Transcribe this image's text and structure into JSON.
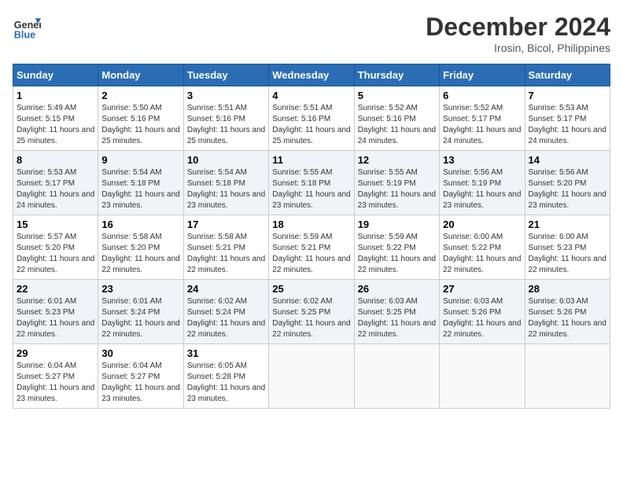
{
  "header": {
    "logo_line1": "General",
    "logo_line2": "Blue",
    "title": "December 2024",
    "subtitle": "Irosin, Bicol, Philippines"
  },
  "weekdays": [
    "Sunday",
    "Monday",
    "Tuesday",
    "Wednesday",
    "Thursday",
    "Friday",
    "Saturday"
  ],
  "weeks": [
    [
      {
        "day": "1",
        "sunrise": "5:49 AM",
        "sunset": "5:15 PM",
        "daylight": "11 hours and 25 minutes."
      },
      {
        "day": "2",
        "sunrise": "5:50 AM",
        "sunset": "5:16 PM",
        "daylight": "11 hours and 25 minutes."
      },
      {
        "day": "3",
        "sunrise": "5:51 AM",
        "sunset": "5:16 PM",
        "daylight": "11 hours and 25 minutes."
      },
      {
        "day": "4",
        "sunrise": "5:51 AM",
        "sunset": "5:16 PM",
        "daylight": "11 hours and 25 minutes."
      },
      {
        "day": "5",
        "sunrise": "5:52 AM",
        "sunset": "5:16 PM",
        "daylight": "11 hours and 24 minutes."
      },
      {
        "day": "6",
        "sunrise": "5:52 AM",
        "sunset": "5:17 PM",
        "daylight": "11 hours and 24 minutes."
      },
      {
        "day": "7",
        "sunrise": "5:53 AM",
        "sunset": "5:17 PM",
        "daylight": "11 hours and 24 minutes."
      }
    ],
    [
      {
        "day": "8",
        "sunrise": "5:53 AM",
        "sunset": "5:17 PM",
        "daylight": "11 hours and 24 minutes."
      },
      {
        "day": "9",
        "sunrise": "5:54 AM",
        "sunset": "5:18 PM",
        "daylight": "11 hours and 23 minutes."
      },
      {
        "day": "10",
        "sunrise": "5:54 AM",
        "sunset": "5:18 PM",
        "daylight": "11 hours and 23 minutes."
      },
      {
        "day": "11",
        "sunrise": "5:55 AM",
        "sunset": "5:18 PM",
        "daylight": "11 hours and 23 minutes."
      },
      {
        "day": "12",
        "sunrise": "5:55 AM",
        "sunset": "5:19 PM",
        "daylight": "11 hours and 23 minutes."
      },
      {
        "day": "13",
        "sunrise": "5:56 AM",
        "sunset": "5:19 PM",
        "daylight": "11 hours and 23 minutes."
      },
      {
        "day": "14",
        "sunrise": "5:56 AM",
        "sunset": "5:20 PM",
        "daylight": "11 hours and 23 minutes."
      }
    ],
    [
      {
        "day": "15",
        "sunrise": "5:57 AM",
        "sunset": "5:20 PM",
        "daylight": "11 hours and 22 minutes."
      },
      {
        "day": "16",
        "sunrise": "5:58 AM",
        "sunset": "5:20 PM",
        "daylight": "11 hours and 22 minutes."
      },
      {
        "day": "17",
        "sunrise": "5:58 AM",
        "sunset": "5:21 PM",
        "daylight": "11 hours and 22 minutes."
      },
      {
        "day": "18",
        "sunrise": "5:59 AM",
        "sunset": "5:21 PM",
        "daylight": "11 hours and 22 minutes."
      },
      {
        "day": "19",
        "sunrise": "5:59 AM",
        "sunset": "5:22 PM",
        "daylight": "11 hours and 22 minutes."
      },
      {
        "day": "20",
        "sunrise": "6:00 AM",
        "sunset": "5:22 PM",
        "daylight": "11 hours and 22 minutes."
      },
      {
        "day": "21",
        "sunrise": "6:00 AM",
        "sunset": "5:23 PM",
        "daylight": "11 hours and 22 minutes."
      }
    ],
    [
      {
        "day": "22",
        "sunrise": "6:01 AM",
        "sunset": "5:23 PM",
        "daylight": "11 hours and 22 minutes."
      },
      {
        "day": "23",
        "sunrise": "6:01 AM",
        "sunset": "5:24 PM",
        "daylight": "11 hours and 22 minutes."
      },
      {
        "day": "24",
        "sunrise": "6:02 AM",
        "sunset": "5:24 PM",
        "daylight": "11 hours and 22 minutes."
      },
      {
        "day": "25",
        "sunrise": "6:02 AM",
        "sunset": "5:25 PM",
        "daylight": "11 hours and 22 minutes."
      },
      {
        "day": "26",
        "sunrise": "6:03 AM",
        "sunset": "5:25 PM",
        "daylight": "11 hours and 22 minutes."
      },
      {
        "day": "27",
        "sunrise": "6:03 AM",
        "sunset": "5:26 PM",
        "daylight": "11 hours and 22 minutes."
      },
      {
        "day": "28",
        "sunrise": "6:03 AM",
        "sunset": "5:26 PM",
        "daylight": "11 hours and 22 minutes."
      }
    ],
    [
      {
        "day": "29",
        "sunrise": "6:04 AM",
        "sunset": "5:27 PM",
        "daylight": "11 hours and 23 minutes."
      },
      {
        "day": "30",
        "sunrise": "6:04 AM",
        "sunset": "5:27 PM",
        "daylight": "11 hours and 23 minutes."
      },
      {
        "day": "31",
        "sunrise": "6:05 AM",
        "sunset": "5:28 PM",
        "daylight": "11 hours and 23 minutes."
      },
      null,
      null,
      null,
      null
    ]
  ]
}
